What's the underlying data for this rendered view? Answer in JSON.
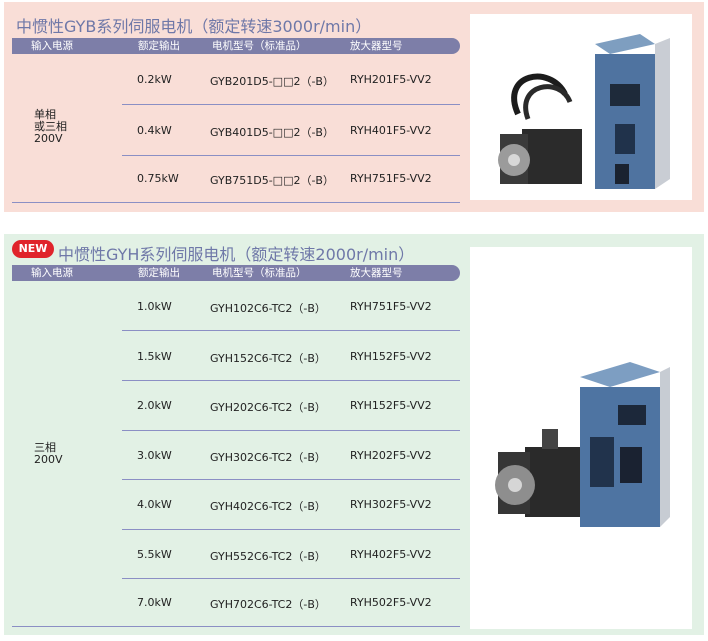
{
  "section1": {
    "title": "中惯性GYB系列伺服电机（额定转速3000r/min）",
    "headers": [
      "输入电源",
      "额定输出",
      "电机型号（标准品）",
      "放大器型号"
    ],
    "input_source": "单相\n或三相\n200V",
    "rows": [
      {
        "output": "0.2kW",
        "motor": "GYB201D5-□□2（-B）",
        "amp": "RYH201F5-VV2"
      },
      {
        "output": "0.4kW",
        "motor": "GYB401D5-□□2（-B）",
        "amp": "RYH401F5-VV2"
      },
      {
        "output": "0.75kW",
        "motor": "GYB751D5-□□2（-B）",
        "amp": "RYH751F5-VV2"
      }
    ]
  },
  "section2": {
    "badge": "NEW",
    "title": "中惯性GYH系列伺服电机（额定转速2000r/min）",
    "headers": [
      "输入电源",
      "额定输出",
      "电机型号（标准品）",
      "放大器型号"
    ],
    "input_source": "三相\n200V",
    "rows": [
      {
        "output": "1.0kW",
        "motor": "GYH102C6-TC2（-B）",
        "amp": "RYH751F5-VV2"
      },
      {
        "output": "1.5kW",
        "motor": "GYH152C6-TC2（-B）",
        "amp": "RYH152F5-VV2"
      },
      {
        "output": "2.0kW",
        "motor": "GYH202C6-TC2（-B）",
        "amp": "RYH152F5-VV2"
      },
      {
        "output": "3.0kW",
        "motor": "GYH302C6-TC2（-B）",
        "amp": "RYH202F5-VV2"
      },
      {
        "output": "4.0kW",
        "motor": "GYH402C6-TC2（-B）",
        "amp": "RYH302F5-VV2"
      },
      {
        "output": "5.5kW",
        "motor": "GYH552C6-TC2（-B）",
        "amp": "RYH402F5-VV2"
      },
      {
        "output": "7.0kW",
        "motor": "GYH702C6-TC2（-B）",
        "amp": "RYH502F5-VV2"
      }
    ]
  },
  "colors": {
    "panel1_bg": "#f9ded7",
    "panel2_bg": "#e2f1e5",
    "header_bg": "#7d7ea8",
    "title": "#6f78a8",
    "badge": "#e0242b"
  }
}
